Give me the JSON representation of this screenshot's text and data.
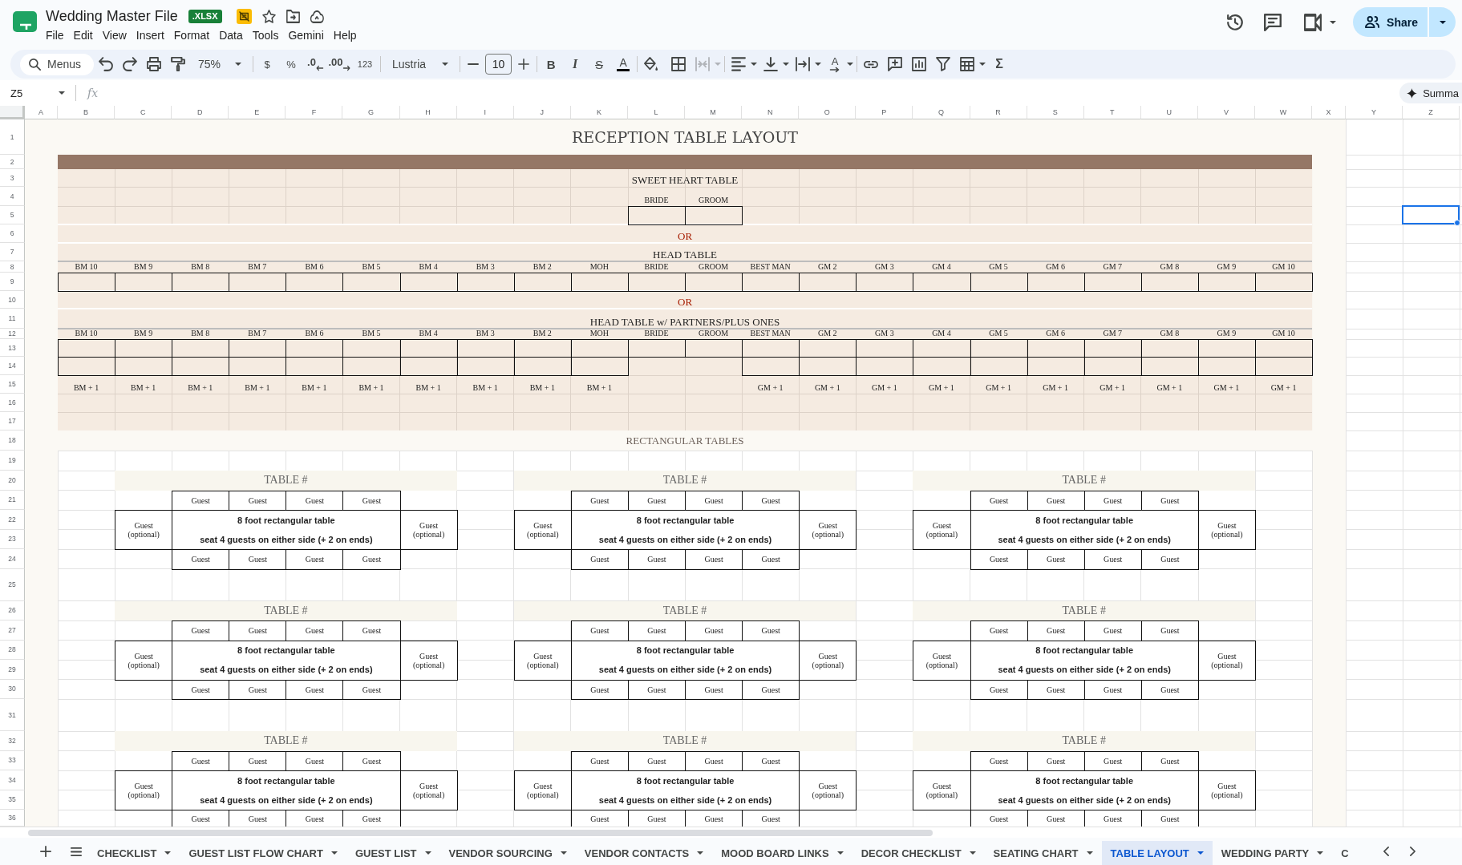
{
  "app": {
    "title": "Wedding Master File",
    "file_badge": ".XLSX",
    "menus": [
      "File",
      "Edit",
      "View",
      "Insert",
      "Format",
      "Data",
      "Tools",
      "Gemini",
      "Help"
    ],
    "share": "Share"
  },
  "toolbar": {
    "search": {
      "placeholder": "Menus"
    },
    "zoom": "75%",
    "currency": "$",
    "percent": "%",
    "decrease_decimal": ".0",
    "increase_decimal": ".00",
    "number_format": "123",
    "font": "Lustria",
    "font_size": "10",
    "bold": "B",
    "italic": "I",
    "strikethrough": "S",
    "text_color": "A",
    "merge_cells": {
      "disabled": true
    },
    "text_rotation": "A",
    "functions": "Σ"
  },
  "formula_bar": {
    "cell_reference": "Z5",
    "fx": "fx",
    "summarize": "Summa"
  },
  "columns": [
    {
      "label": "A",
      "selected": false
    },
    {
      "label": "B",
      "selected": false
    },
    {
      "label": "C",
      "selected": false
    },
    {
      "label": "D",
      "selected": false
    },
    {
      "label": "E",
      "selected": false
    },
    {
      "label": "F",
      "selected": false
    },
    {
      "label": "G",
      "selected": false
    },
    {
      "label": "H",
      "selected": false
    },
    {
      "label": "I",
      "selected": false
    },
    {
      "label": "J",
      "selected": false
    },
    {
      "label": "K",
      "selected": false
    },
    {
      "label": "L",
      "selected": false
    },
    {
      "label": "M",
      "selected": false
    },
    {
      "label": "N",
      "selected": false
    },
    {
      "label": "O",
      "selected": false
    },
    {
      "label": "P",
      "selected": false
    },
    {
      "label": "Q",
      "selected": false
    },
    {
      "label": "R",
      "selected": false
    },
    {
      "label": "S",
      "selected": false
    },
    {
      "label": "T",
      "selected": false
    },
    {
      "label": "U",
      "selected": false
    },
    {
      "label": "V",
      "selected": false
    },
    {
      "label": "W",
      "selected": false
    },
    {
      "label": "X",
      "selected": false
    },
    {
      "label": "Y",
      "selected": false
    },
    {
      "label": "Z",
      "selected": true
    }
  ],
  "rows": [
    {
      "label": "1",
      "selected": false
    },
    {
      "label": "2",
      "selected": false
    },
    {
      "label": "3",
      "selected": false
    },
    {
      "label": "4",
      "selected": false
    },
    {
      "label": "5",
      "selected": true
    },
    {
      "label": "6",
      "selected": false
    },
    {
      "label": "7",
      "selected": false
    },
    {
      "label": "8",
      "selected": false
    },
    {
      "label": "9",
      "selected": false
    },
    {
      "label": "10",
      "selected": false
    },
    {
      "label": "11",
      "selected": false
    },
    {
      "label": "12",
      "selected": false
    },
    {
      "label": "13",
      "selected": false
    },
    {
      "label": "14",
      "selected": false
    },
    {
      "label": "15",
      "selected": false
    },
    {
      "label": "16",
      "selected": false
    },
    {
      "label": "17",
      "selected": false
    },
    {
      "label": "18",
      "selected": false
    },
    {
      "label": "19",
      "selected": false
    },
    {
      "label": "20",
      "selected": false
    },
    {
      "label": "21",
      "selected": false
    },
    {
      "label": "22",
      "selected": false
    },
    {
      "label": "23",
      "selected": false
    },
    {
      "label": "24",
      "selected": false
    },
    {
      "label": "25",
      "selected": false
    },
    {
      "label": "26",
      "selected": false
    },
    {
      "label": "27",
      "selected": false
    },
    {
      "label": "28",
      "selected": false
    },
    {
      "label": "29",
      "selected": false
    },
    {
      "label": "30",
      "selected": false
    },
    {
      "label": "31",
      "selected": false
    },
    {
      "label": "32",
      "selected": false
    },
    {
      "label": "33",
      "selected": false
    },
    {
      "label": "34",
      "selected": false
    },
    {
      "label": "35",
      "selected": false
    },
    {
      "label": "36",
      "selected": false
    }
  ],
  "sheet": {
    "title": "RECEPTION TABLE LAYOUT",
    "sweetheart_table": {
      "heading": "SWEET HEART TABLE",
      "seats": [
        "BRIDE",
        "GROOM"
      ]
    },
    "head_table": {
      "separator": "OR",
      "heading": "HEAD TABLE",
      "seats": [
        "BM 10",
        "BM 9",
        "BM 8",
        "BM 7",
        "BM 6",
        "BM 5",
        "BM 4",
        "BM 3",
        "BM 2",
        "MOH",
        "BRIDE",
        "GROOM",
        "BEST MAN",
        "GM 2",
        "GM 3",
        "GM 4",
        "GM 5",
        "GM 6",
        "GM 7",
        "GM 8",
        "GM 9",
        "GM 10"
      ]
    },
    "partners_head_table": {
      "separator": "OR",
      "heading": "HEAD TABLE w/ PARTNERS/PLUS ONES",
      "seats": [
        "BM 10",
        "BM 9",
        "BM 8",
        "BM 7",
        "BM 6",
        "BM 5",
        "BM 4",
        "BM 3",
        "BM 2",
        "MOH",
        "BRIDE",
        "GROOM",
        "BEST MAN",
        "GM 2",
        "GM 3",
        "GM 4",
        "GM 5",
        "GM 6",
        "GM 7",
        "GM 8",
        "GM 9",
        "GM 10"
      ],
      "plus_ones_left": [
        "BM + 1",
        "BM + 1",
        "BM + 1",
        "BM + 1",
        "BM + 1",
        "BM + 1",
        "BM + 1",
        "BM + 1",
        "BM + 1",
        "BM + 1"
      ],
      "plus_ones_right": [
        "GM + 1",
        "GM + 1",
        "GM + 1",
        "GM + 1",
        "GM + 1",
        "GM + 1",
        "GM + 1",
        "GM + 1",
        "GM + 1",
        "GM + 1"
      ]
    },
    "rectangular_tables": {
      "heading": "RECTANGULAR TABLES",
      "tables": [
        {
          "heading": "TABLE #",
          "top_seats": [
            "Guest",
            "Guest",
            "Guest",
            "Guest"
          ],
          "left_end": "Guest (optional)",
          "description": [
            "8 foot rectangular table",
            "seat 4 guests on either side (+ 2 on ends)"
          ],
          "right_end": "Guest (optional)",
          "bottom_seats": [
            "Guest",
            "Guest",
            "Guest",
            "Guest"
          ]
        },
        {
          "heading": "TABLE #",
          "top_seats": [
            "Guest",
            "Guest",
            "Guest",
            "Guest"
          ],
          "left_end": "Guest (optional)",
          "description": [
            "8 foot rectangular table",
            "seat 4 guests on either side (+ 2 on ends)"
          ],
          "right_end": "Guest (optional)",
          "bottom_seats": [
            "Guest",
            "Guest",
            "Guest",
            "Guest"
          ]
        },
        {
          "heading": "TABLE #",
          "top_seats": [
            "Guest",
            "Guest",
            "Guest",
            "Guest"
          ],
          "left_end": "Guest (optional)",
          "description": [
            "8 foot rectangular table",
            "seat 4 guests on either side (+ 2 on ends)"
          ],
          "right_end": "Guest (optional)",
          "bottom_seats": [
            "Guest",
            "Guest",
            "Guest",
            "Guest"
          ]
        },
        {
          "heading": "TABLE #",
          "top_seats": [
            "Guest",
            "Guest",
            "Guest",
            "Guest"
          ],
          "left_end": "Guest (optional)",
          "description": [
            "8 foot rectangular table",
            "seat 4 guests on either side (+ 2 on ends)"
          ],
          "right_end": "Guest (optional)",
          "bottom_seats": [
            "Guest",
            "Guest",
            "Guest",
            "Guest"
          ]
        },
        {
          "heading": "TABLE #",
          "top_seats": [
            "Guest",
            "Guest",
            "Guest",
            "Guest"
          ],
          "left_end": "Guest (optional)",
          "description": [
            "8 foot rectangular table",
            "seat 4 guests on either side (+ 2 on ends)"
          ],
          "right_end": "Guest (optional)",
          "bottom_seats": [
            "Guest",
            "Guest",
            "Guest",
            "Guest"
          ]
        },
        {
          "heading": "TABLE #",
          "top_seats": [
            "Guest",
            "Guest",
            "Guest",
            "Guest"
          ],
          "left_end": "Guest (optional)",
          "description": [
            "8 foot rectangular table",
            "seat 4 guests on either side (+ 2 on ends)"
          ],
          "right_end": "Guest (optional)",
          "bottom_seats": [
            "Guest",
            "Guest",
            "Guest",
            "Guest"
          ]
        },
        {
          "heading": "TABLE #",
          "top_seats": [
            "Guest",
            "Guest",
            "Guest",
            "Guest"
          ],
          "left_end": "Guest (optional)",
          "description": [
            "8 foot rectangular table",
            "seat 4 guests on either side (+ 2 on ends)"
          ],
          "right_end": "Guest (optional)",
          "bottom_seats": [
            "Guest",
            "Guest",
            "Guest",
            "Guest"
          ]
        },
        {
          "heading": "TABLE #",
          "top_seats": [
            "Guest",
            "Guest",
            "Guest",
            "Guest"
          ],
          "left_end": "Guest (optional)",
          "description": [
            "8 foot rectangular table",
            "seat 4 guests on either side (+ 2 on ends)"
          ],
          "right_end": "Guest (optional)",
          "bottom_seats": [
            "Guest",
            "Guest",
            "Guest",
            "Guest"
          ]
        },
        {
          "heading": "TABLE #",
          "top_seats": [
            "Guest",
            "Guest",
            "Guest",
            "Guest"
          ],
          "left_end": "Guest (optional)",
          "description": [
            "8 foot rectangular table",
            "seat 4 guests on either side (+ 2 on ends)"
          ],
          "right_end": "Guest (optional)",
          "bottom_seats": [
            "Guest",
            "Guest",
            "Guest",
            "Guest"
          ]
        }
      ]
    }
  },
  "sheet_tabs": [
    {
      "label": "CHECKLIST",
      "selected": false
    },
    {
      "label": "GUEST LIST FLOW CHART",
      "selected": false
    },
    {
      "label": "GUEST LIST",
      "selected": false
    },
    {
      "label": "VENDOR SOURCING",
      "selected": false
    },
    {
      "label": "VENDOR CONTACTS",
      "selected": false
    },
    {
      "label": "MOOD BOARD LINKS",
      "selected": false
    },
    {
      "label": "DECOR CHECKLIST",
      "selected": false
    },
    {
      "label": "SEATING CHART",
      "selected": false
    },
    {
      "label": "TABLE LAYOUT",
      "selected": true
    },
    {
      "label": "WEDDING PARTY",
      "selected": false
    },
    {
      "label": "C",
      "selected": false
    }
  ]
}
